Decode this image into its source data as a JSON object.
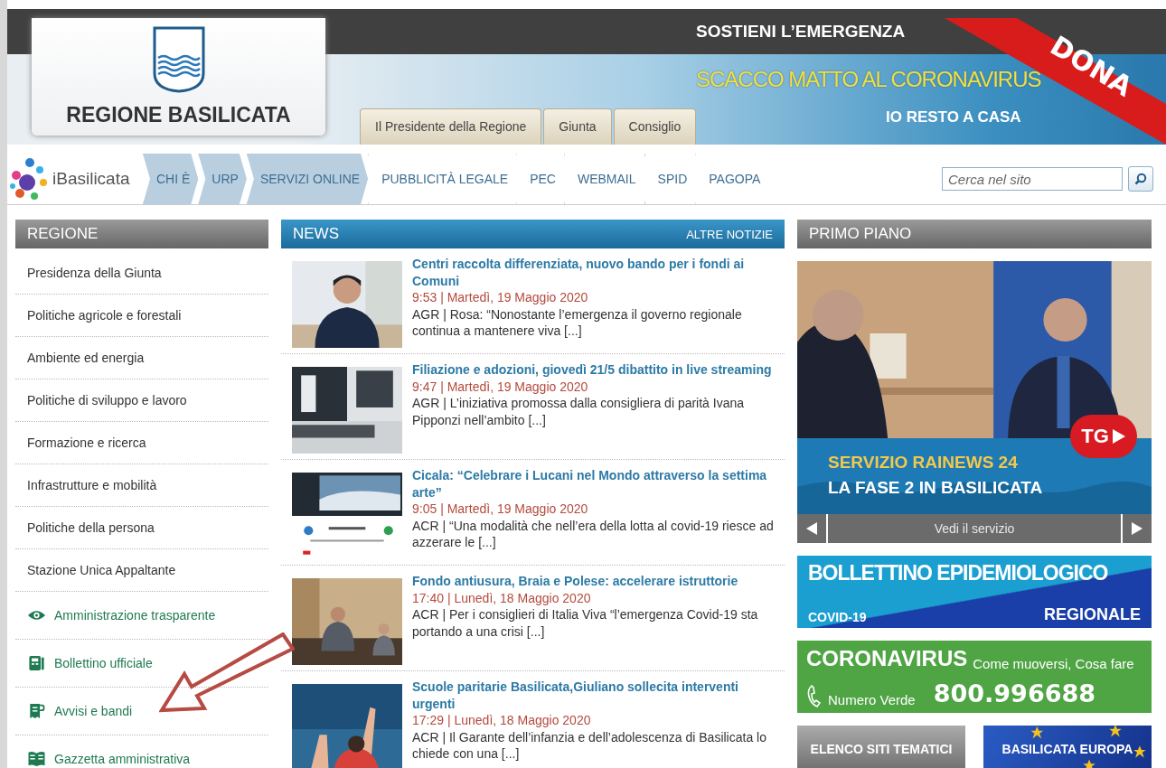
{
  "header": {
    "logo_text": "REGIONE BASILICATA",
    "headline": "SOSTIENI L’EMERGENZA",
    "slogan": "SCACCO MATTO AL CORONAVIRUS",
    "tagline": "IO RESTO A CASA",
    "donate": "DONA",
    "tabs": [
      {
        "label": "Il Presidente della Regione"
      },
      {
        "label": "Giunta"
      },
      {
        "label": "Consiglio"
      }
    ]
  },
  "nav": {
    "brand": "iBasilicata",
    "items": [
      {
        "label": "CHI È",
        "highlighted": true
      },
      {
        "label": "URP",
        "highlighted": true
      },
      {
        "label": "SERVIZI ONLINE",
        "highlighted": true
      },
      {
        "label": "PUBBLICITÀ LEGALE",
        "highlighted": false
      },
      {
        "label": "PEC",
        "highlighted": false
      },
      {
        "label": "WEBMAIL",
        "highlighted": false
      },
      {
        "label": "SPID",
        "highlighted": false
      },
      {
        "label": "PAGOPA",
        "highlighted": false
      }
    ],
    "search_placeholder": "Cerca nel sito"
  },
  "sidebar": {
    "title": "REGIONE",
    "items": [
      {
        "label": "Presidenza della Giunta",
        "kind": "plain"
      },
      {
        "label": "Politiche agricole e forestali",
        "kind": "plain"
      },
      {
        "label": "Ambiente ed energia",
        "kind": "plain"
      },
      {
        "label": "Politiche di sviluppo e lavoro",
        "kind": "plain"
      },
      {
        "label": "Formazione e ricerca",
        "kind": "plain"
      },
      {
        "label": "Infrastrutture e mobilità",
        "kind": "plain"
      },
      {
        "label": "Politiche della persona",
        "kind": "plain"
      },
      {
        "label": "Stazione Unica Appaltante",
        "kind": "plain"
      },
      {
        "label": "Amministrazione trasparente",
        "kind": "featured"
      },
      {
        "label": "Bollettino ufficiale",
        "kind": "featured"
      },
      {
        "label": "Avvisi e bandi",
        "kind": "featured"
      },
      {
        "label": "Gazzetta amministrativa",
        "kind": "featured"
      }
    ]
  },
  "news": {
    "title": "NEWS",
    "more": "ALTRE NOTIZIE",
    "items": [
      {
        "headline": "Centri raccolta differenziata, nuovo bando per i fondi ai Comuni",
        "meta": "9:53 | Martedì, 19 Maggio 2020",
        "summary": "AGR | Rosa: “Nonostante l’emergenza il governo regionale continua a mantenere viva [...]"
      },
      {
        "headline": "Filiazione e adozioni, giovedì 21/5 dibattito in live streaming",
        "meta": "9:47 | Martedì, 19 Maggio 2020",
        "summary": "AGR | L’iniziativa promossa dalla consigliera di parità Ivana Pipponzi nell’ambito [...]"
      },
      {
        "headline": "Cicala: “Celebrare i Lucani nel Mondo attraverso la settima arte”",
        "meta": "9:05 | Martedì, 19 Maggio 2020",
        "summary": "ACR | “Una modalità che nell’era della lotta al covid-19 riesce ad azzerare le [...]"
      },
      {
        "headline": "Fondo antiusura, Braia e Polese: accelerare istruttorie",
        "meta": "17:40 | Lunedì, 18 Maggio 2020",
        "summary": "ACR | Per i consiglieri di Italia Viva “l’emergenza Covid-19 sta portando a una crisi [...]"
      },
      {
        "headline": "Scuole paritarie Basilicata,Giuliano sollecita interventi urgenti",
        "meta": "17:29 | Lunedì, 18 Maggio 2020",
        "summary": "ACR | Il Garante dell’infanzia e dell’adolescenza di Basilicata lo chiede con una [...]"
      }
    ]
  },
  "primo_piano": {
    "title": "PRIMO PIANO",
    "feature_line_1": "SERVIZIO RAINEWS 24",
    "feature_line_2": "LA FASE 2 IN BASILICATA",
    "badge": "TG",
    "caption": "Vedi il servizio",
    "bulletin": {
      "title": "BOLLETTINO EPIDEMIOLOGICO",
      "tag": "COVID-19",
      "subtitle": "REGIONALE"
    },
    "hotline": {
      "title": "CORONAVIRUS",
      "subtitle": "Come muoversi, Cosa fare",
      "label": "Numero Verde",
      "phone": "800.996688"
    },
    "links": [
      {
        "label": "ELENCO SITI TEMATICI",
        "kind": "gray"
      },
      {
        "label": "BASILICATA EUROPA",
        "kind": "europe"
      }
    ]
  }
}
